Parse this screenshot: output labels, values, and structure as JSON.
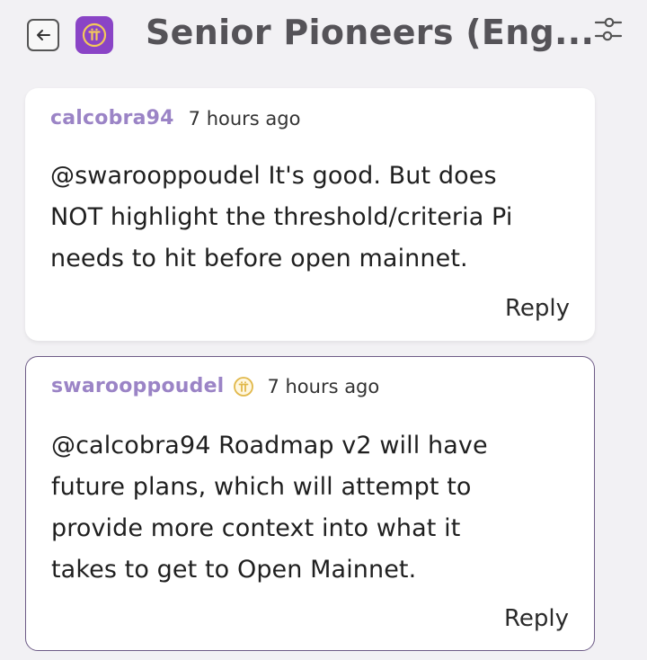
{
  "header": {
    "back_icon": "arrow-left-icon",
    "app_logo_icon": "pi-network-logo",
    "title": "Senior Pioneers (Eng...",
    "filter_icon": "sliders-icon"
  },
  "colors": {
    "background": "#f2f1f4",
    "author": "#9b84c6",
    "logo": "#8a44c6",
    "badge": "#e1b84a",
    "highlight_border": "#6d5b86"
  },
  "comments": [
    {
      "author": "calcobra94",
      "time": "7 hours ago",
      "text": "@swarooppoudel It's good. But does\nNOT highlight the threshold/criteria Pi\nneeds to hit before open mainnet.",
      "reply_label": "Reply",
      "badge": null
    },
    {
      "author": "swarooppoudel",
      "time": "7 hours ago",
      "text": "@calcobra94 Roadmap v2 will have\nfuture plans, which will attempt to\nprovide more context into what it\ntakes to get to Open Mainnet.",
      "reply_label": "Reply",
      "badge": "pi-badge-icon"
    }
  ]
}
